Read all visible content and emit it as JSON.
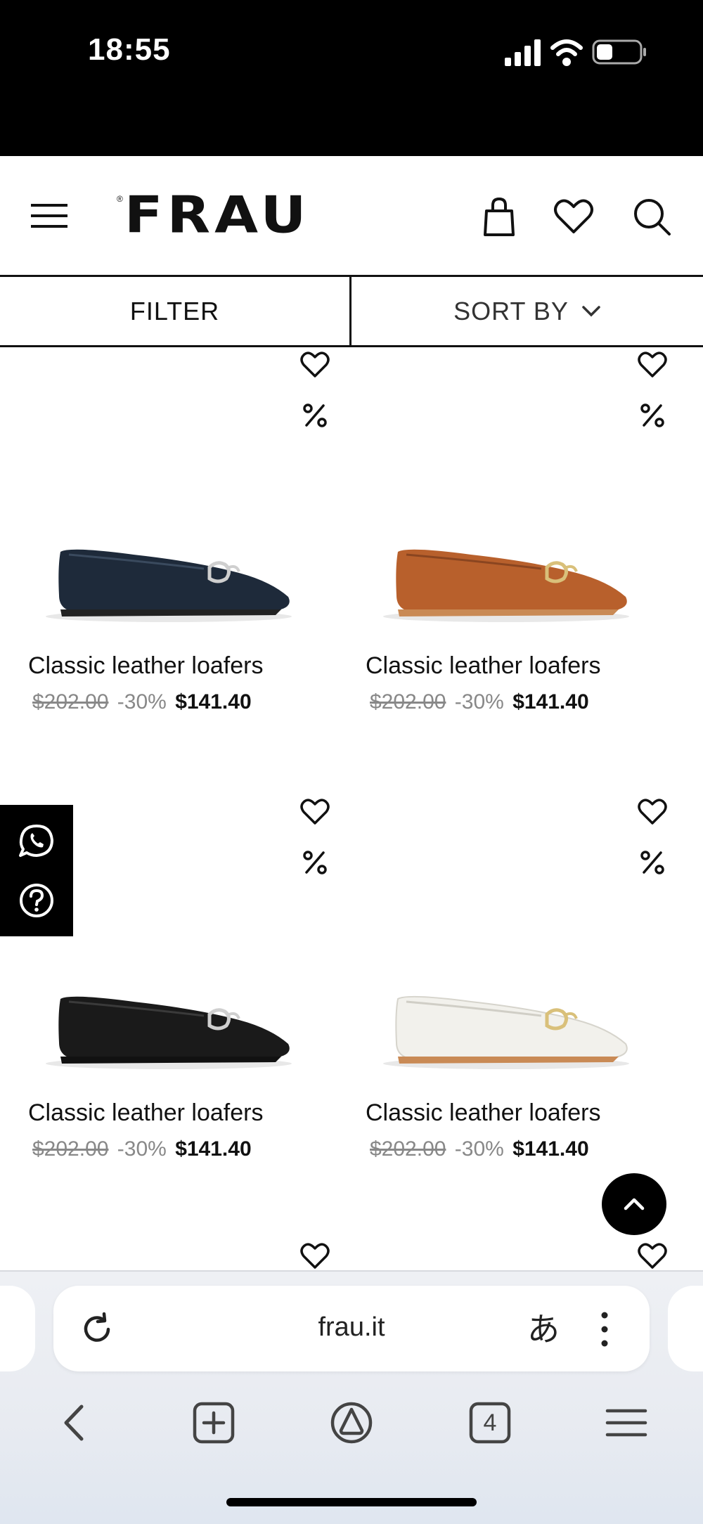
{
  "status_bar": {
    "time": "18:55"
  },
  "header": {
    "logo": "FRAU"
  },
  "filter_bar": {
    "filter_label": "FILTER",
    "sort_label": "SORT BY"
  },
  "products": [
    {
      "name": "Classic leather loafers",
      "old_price": "$202.00",
      "discount": "-30%",
      "price": "$141.40",
      "color": "#1e2a3a"
    },
    {
      "name": "Classic leather loafers",
      "old_price": "$202.00",
      "discount": "-30%",
      "price": "$141.40",
      "color": "#b8602c"
    },
    {
      "name": "Classic leather loafers",
      "old_price": "$202.00",
      "discount": "-30%",
      "price": "$141.40",
      "color": "#1a1a1a"
    },
    {
      "name": "Classic leather loafers",
      "old_price": "$202.00",
      "discount": "-30%",
      "price": "$141.40",
      "color": "#f2f1ec"
    }
  ],
  "browser": {
    "url": "frau.it",
    "translate_glyph": "あ",
    "tab_count": "4"
  }
}
